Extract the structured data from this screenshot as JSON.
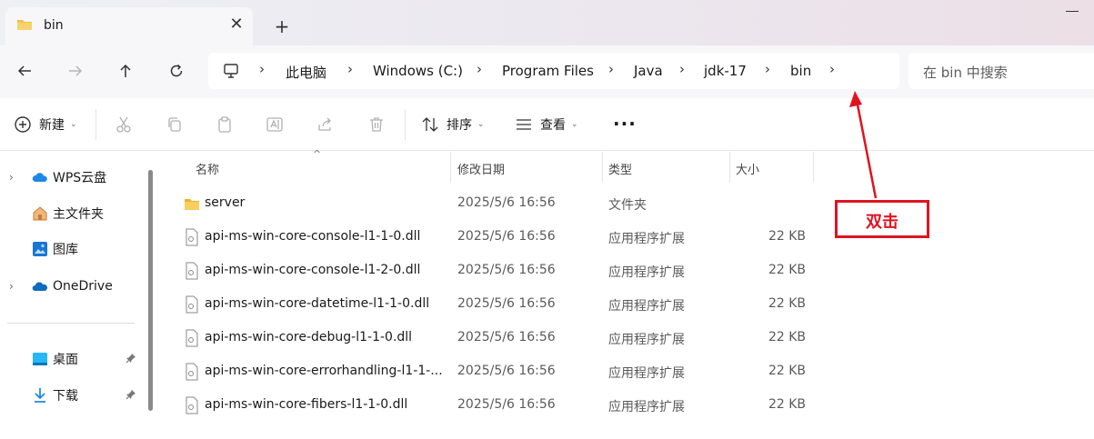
{
  "window": {
    "tab_title": "bin",
    "close_tab_glyph": "✕",
    "new_tab_glyph": "+"
  },
  "nav": {
    "back_icon": "arrow-left-icon",
    "forward_icon": "arrow-right-icon",
    "up_icon": "arrow-up-icon",
    "refresh_icon": "refresh-icon"
  },
  "address": {
    "crumbs": [
      "此电脑",
      "Windows (C:)",
      "Program Files",
      "Java",
      "jdk-17",
      "bin"
    ],
    "chevron": "›"
  },
  "search": {
    "placeholder": "在 bin 中搜索"
  },
  "toolbar": {
    "new_label": "新建",
    "sort_label": "排序",
    "view_label": "查看",
    "more_label": "···",
    "caret": "⌄"
  },
  "sidebar": {
    "items": [
      {
        "label": "WPS云盘",
        "icon": "cloud-icon"
      },
      {
        "label": "主文件夹",
        "icon": "home-icon"
      },
      {
        "label": "图库",
        "icon": "gallery-icon"
      },
      {
        "label": "OneDrive",
        "icon": "onedrive-icon"
      },
      {
        "label": "桌面",
        "icon": "desktop-icon"
      },
      {
        "label": "下载",
        "icon": "download-icon"
      }
    ],
    "expander": "›",
    "pin": "📌"
  },
  "columns": {
    "name": "名称",
    "modified": "修改日期",
    "type": "类型",
    "size": "大小",
    "sort_glyph": "^"
  },
  "files": [
    {
      "name": "server",
      "modified": "2025/5/6 16:56",
      "type": "文件夹",
      "size": ""
    },
    {
      "name": "api-ms-win-core-console-l1-1-0.dll",
      "modified": "2025/5/6 16:56",
      "type": "应用程序扩展",
      "size": "22 KB"
    },
    {
      "name": "api-ms-win-core-console-l1-2-0.dll",
      "modified": "2025/5/6 16:56",
      "type": "应用程序扩展",
      "size": "22 KB"
    },
    {
      "name": "api-ms-win-core-datetime-l1-1-0.dll",
      "modified": "2025/5/6 16:56",
      "type": "应用程序扩展",
      "size": "22 KB"
    },
    {
      "name": "api-ms-win-core-debug-l1-1-0.dll",
      "modified": "2025/5/6 16:56",
      "type": "应用程序扩展",
      "size": "22 KB"
    },
    {
      "name": "api-ms-win-core-errorhandling-l1-1-...",
      "modified": "2025/5/6 16:56",
      "type": "应用程序扩展",
      "size": "22 KB"
    },
    {
      "name": "api-ms-win-core-fibers-l1-1-0.dll",
      "modified": "2025/5/6 16:56",
      "type": "应用程序扩展",
      "size": "22 KB"
    }
  ],
  "annotation": {
    "text": "双击",
    "color": "#e0131f"
  },
  "colors": {
    "accent": "#0067c0",
    "folder": "#f2c14e",
    "annotation": "#e0131f"
  }
}
